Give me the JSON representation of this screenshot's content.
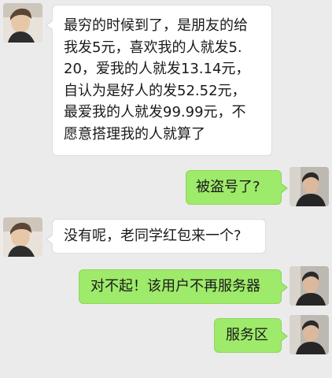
{
  "messages": [
    {
      "sender": "friend",
      "lines": [
        "最穷的时候到了，是朋友的给",
        "我发5元，喜欢我的人就发5.",
        "20，爱我的人就发13.14元，",
        "自认为是好人的发52.52元，",
        "最爱我的人就发99.99元，不",
        "愿意搭理我的人就算了"
      ]
    },
    {
      "sender": "me",
      "text": "被盗号了?"
    },
    {
      "sender": "friend",
      "text": "没有呢，老同学红包来一个?"
    },
    {
      "sender": "me",
      "text": "对不起！该用户不再服务器"
    },
    {
      "sender": "me",
      "text": "服务区"
    }
  ],
  "colors": {
    "background": "#ebebeb",
    "incoming_bubble": "#ffffff",
    "outgoing_bubble": "#9eea6a"
  },
  "icons": {
    "friend_avatar": "friend-avatar-icon",
    "my_avatar": "my-avatar-icon"
  }
}
